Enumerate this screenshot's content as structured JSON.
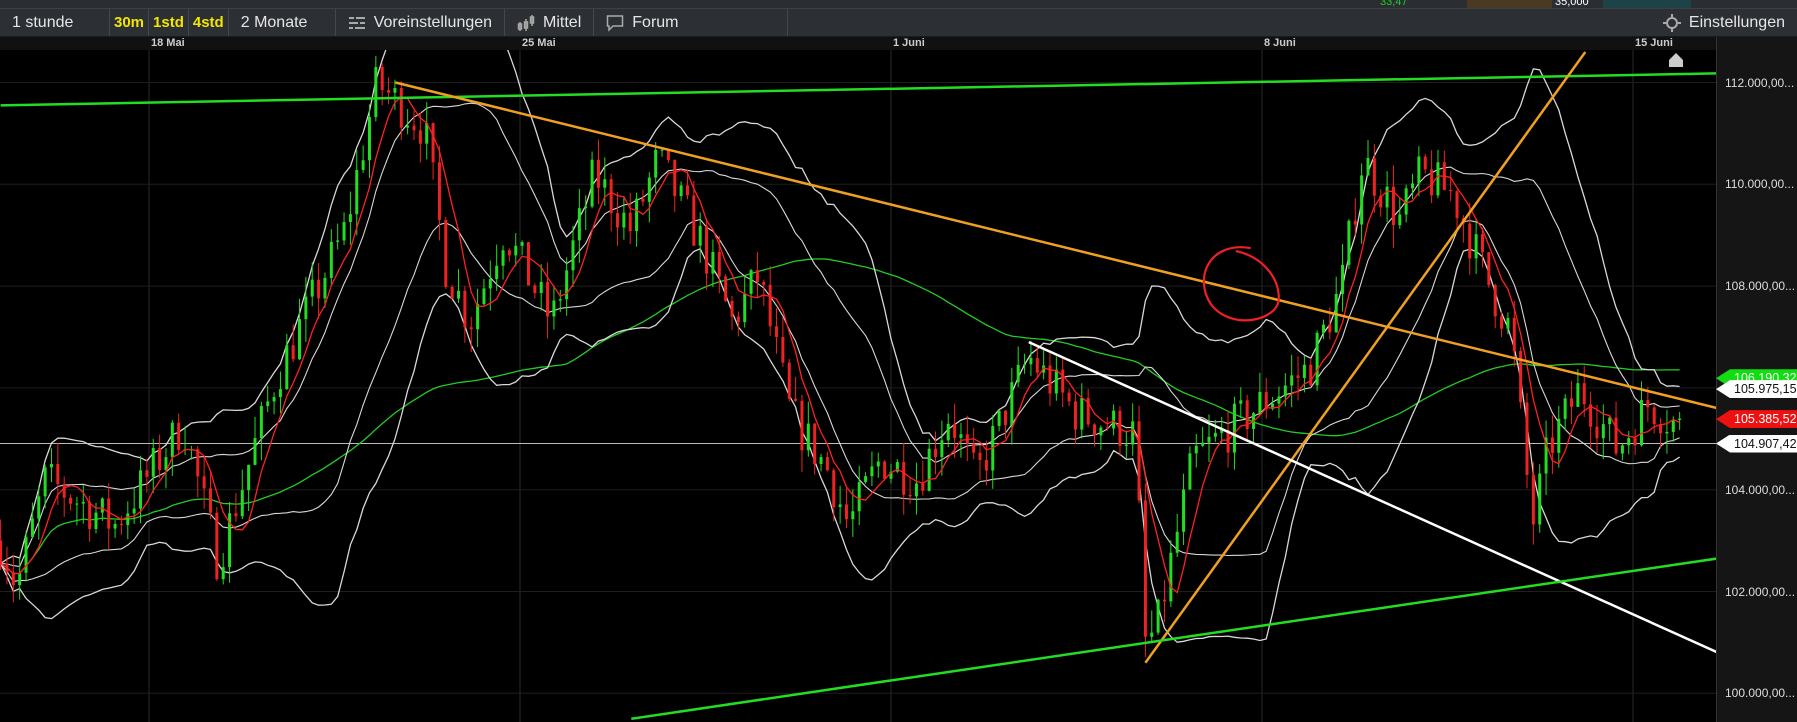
{
  "top_strip": {
    "value_green": "33,47",
    "value_white": "35,000"
  },
  "toolbar": {
    "interval": "1 stunde",
    "quick": [
      "30m",
      "1std",
      "4std"
    ],
    "range": "2 Monate",
    "presets": "Voreinstellungen",
    "indicator": "Mittel",
    "forum": "Forum",
    "settings": "Einstellungen"
  },
  "dates": [
    {
      "label": "18 Mai",
      "day": 0
    },
    {
      "label": "25 Mai",
      "day": 7
    },
    {
      "label": "1 Juni",
      "day": 14
    },
    {
      "label": "8 Juni",
      "day": 21
    },
    {
      "label": "15 Juni",
      "day": 28
    }
  ],
  "axis_ticks": [
    "112.000,00...",
    "110.000,00...",
    "108.000,00...",
    "104.000,00...",
    "102.000,00...",
    "100.000,00..."
  ],
  "axis_values": [
    112,
    110,
    108,
    104,
    102,
    100
  ],
  "price_labels": [
    {
      "text": "106.190,327",
      "value": 106.19,
      "bg": "#11dd11",
      "fg": "#ffffff"
    },
    {
      "text": "105.975,150",
      "value": 105.975,
      "bg": "#ffffff",
      "fg": "#111111"
    },
    {
      "text": "105.385,528",
      "value": 105.3855,
      "bg": "#ee1111",
      "fg": "#ffffff"
    },
    {
      "text": "104.907,428",
      "value": 104.907,
      "bg": "#ffffff",
      "fg": "#111111"
    }
  ],
  "colors": {
    "up": "#22dd22",
    "down": "#ee2222",
    "ma_short": "#ff2020",
    "ma_long": "#22cc22",
    "bands": "#d8d8d8",
    "trend_green": "#22dd22",
    "trend_orange": "#f0a020",
    "trend_white": "#ffffff",
    "circle": "#ee2020"
  },
  "chart_data": {
    "type": "candlestick",
    "x_unit": "days since 18 Mai",
    "price_keypoints": [
      [
        -2.8,
        103.0
      ],
      [
        -2.5,
        102.1
      ],
      [
        -1.95,
        104.2
      ],
      [
        -0.65,
        103.3
      ],
      [
        0.65,
        105.3
      ],
      [
        1.3,
        102.6
      ],
      [
        2.4,
        106.2
      ],
      [
        3.7,
        109.1
      ],
      [
        4.3,
        112.0
      ],
      [
        5.2,
        111.1
      ],
      [
        5.6,
        108.4
      ],
      [
        6.05,
        107.3
      ],
      [
        6.7,
        109.1
      ],
      [
        7.6,
        107.3
      ],
      [
        8.4,
        110.2
      ],
      [
        9.1,
        109.1
      ],
      [
        9.6,
        110.5
      ],
      [
        10.4,
        108.9
      ],
      [
        11.0,
        107.3
      ],
      [
        11.5,
        108.2
      ],
      [
        12.1,
        105.5
      ],
      [
        12.8,
        104.4
      ],
      [
        13.2,
        103.3
      ],
      [
        13.8,
        104.6
      ],
      [
        14.5,
        104.2
      ],
      [
        15.1,
        105.5
      ],
      [
        15.6,
        104.2
      ],
      [
        16.6,
        106.6
      ],
      [
        17.5,
        105.5
      ],
      [
        18.6,
        105.1
      ],
      [
        18.8,
        101.0
      ],
      [
        19.0,
        101.2
      ],
      [
        19.7,
        104.6
      ],
      [
        21.0,
        105.7
      ],
      [
        21.9,
        106.4
      ],
      [
        22.5,
        108.0
      ],
      [
        22.9,
        110.5
      ],
      [
        23.6,
        109.3
      ],
      [
        24.0,
        110.2
      ],
      [
        24.6,
        109.8
      ],
      [
        25.3,
        108.0
      ],
      [
        25.7,
        107.1
      ],
      [
        26.1,
        103.3
      ],
      [
        26.4,
        104.8
      ],
      [
        27.0,
        106.0
      ],
      [
        27.7,
        104.8
      ],
      [
        28.3,
        105.7
      ],
      [
        28.9,
        105.2
      ]
    ],
    "trendlines": [
      {
        "color": "trend_green",
        "from": [
          -2.8,
          111.55
        ],
        "to": [
          29.6,
          112.18
        ]
      },
      {
        "color": "trend_orange",
        "from": [
          4.65,
          112.0
        ],
        "to": [
          29.6,
          105.6
        ]
      },
      {
        "color": "trend_orange",
        "from": [
          18.8,
          100.6
        ],
        "to": [
          27.1,
          112.6
        ]
      },
      {
        "color": "trend_white",
        "from": [
          16.6,
          106.9
        ],
        "to": [
          29.6,
          100.8
        ]
      },
      {
        "color": "trend_green",
        "from": [
          9.1,
          99.5
        ],
        "to": [
          29.6,
          102.65
        ]
      }
    ],
    "hline": 104.907,
    "circle_annotation": {
      "center": [
        20.6,
        108.0
      ]
    },
    "ylim": [
      99.2,
      113.1
    ]
  }
}
